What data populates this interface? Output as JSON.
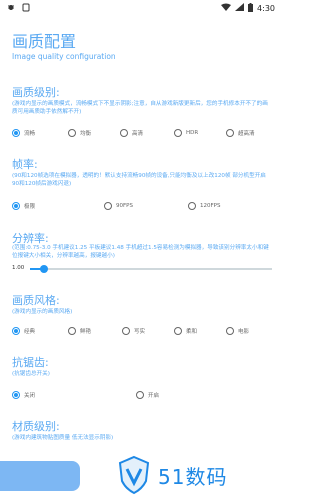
{
  "status_bar": {
    "time": "4:30",
    "left_icons": [
      "bug-icon",
      "notification-icon"
    ],
    "right_icons": [
      "wifi-icon",
      "signal-icon",
      "battery-icon"
    ]
  },
  "header": {
    "title": "画质配置",
    "subtitle": "Image quality configuration"
  },
  "sections": [
    {
      "title": "画质级别:",
      "desc": "(游戏内显示的画质模式，流畅模式下不显示阴影;注意，自从游戏新版更新后，您的手机修本开不了的画质可用画质助手依然解不开)",
      "options": [
        "流畅",
        "均衡",
        "高清",
        "HDR",
        "超高清"
      ],
      "selected": 0
    },
    {
      "title": "帧率:",
      "desc": "(90和120帧选项在模拟器，透明的！默认支持流畅90帧的设备,只能均衡及以上改120帧 部分机型开启90和120帧后游戏闪退)",
      "options": [
        "极限",
        "90FPS",
        "120FPS"
      ],
      "selected": 0
    },
    {
      "title": "分辨率:",
      "desc": "(范围:0.75-3.0 手机建议1.25 平板建议1.48 手机超过1.5容易检测为模拟器，导致该别分辨率太小和键位报键大小相关，分辨率越高，报键越小)",
      "slider_value": "1.00",
      "slider_fraction": 0.04
    },
    {
      "title": "画质风格:",
      "desc": "(游戏内显示的画质风格)",
      "options": [
        "经典",
        "鲜艳",
        "写实",
        "柔和",
        "电影"
      ],
      "selected": 0
    },
    {
      "title": "抗锯齿:",
      "desc": "(抗锯齿总开关)",
      "options": [
        "关闭",
        "开启"
      ],
      "selected": 0
    },
    {
      "title": "材质级别:",
      "desc": "(游戏内建筑物贴图质量 低无法显示阴影)"
    }
  ],
  "watermark": {
    "text": "51数码"
  },
  "colors": {
    "accent": "#5aa9f2",
    "radio": "#2196f3",
    "button": "#7db7f3"
  }
}
